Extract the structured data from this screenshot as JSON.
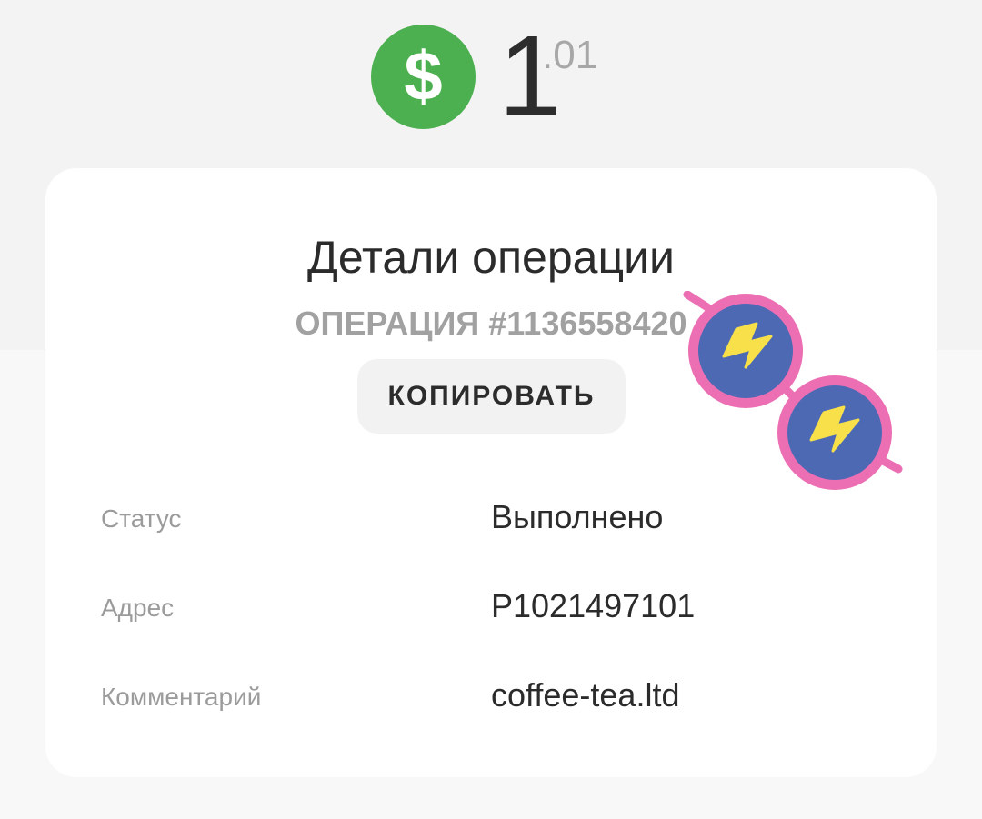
{
  "header": {
    "currency_icon": "dollar-icon",
    "currency_symbol": "$",
    "amount_integer": "1",
    "amount_fraction": ".01",
    "colors": {
      "currency_icon_bg": "#4cb050",
      "amount_text": "#2d2d2d",
      "amount_fraction_text": "#a7a7a7"
    }
  },
  "card": {
    "title": "Детали операции",
    "operation_number": "ОПЕРАЦИЯ #1136558420",
    "copy_button_label": "КОПИРОВАТЬ",
    "details": [
      {
        "label": "Статус",
        "value": "Выполнено"
      },
      {
        "label": "Адрес",
        "value": "P1021497101"
      },
      {
        "label": "Комментарий",
        "value": "coffee-tea.ltd"
      }
    ]
  },
  "sticker": {
    "icon": "sunglasses-lightning-sticker",
    "colors": {
      "frame": "#ec6fb4",
      "lens": "#4d69b4",
      "bolt": "#f7e04a"
    }
  }
}
